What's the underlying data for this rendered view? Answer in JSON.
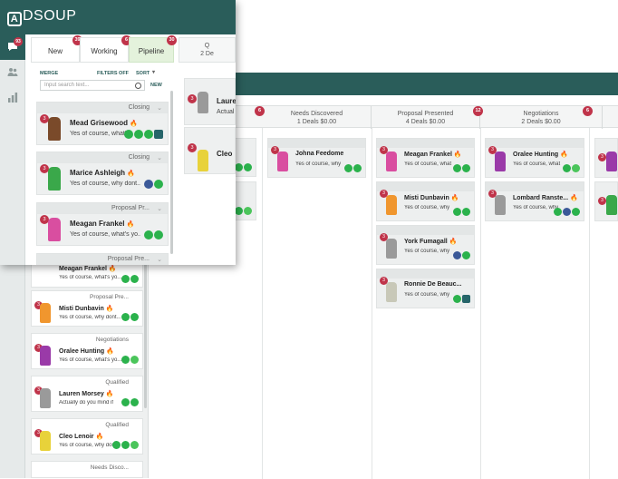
{
  "brand": {
    "name": "DSOUP",
    "mark": "A"
  },
  "front": {
    "rail": {
      "chat_badge": "93"
    },
    "tabs": [
      {
        "label": "New",
        "badge": "39"
      },
      {
        "label": "Working",
        "badge": "6"
      },
      {
        "label": "Pipeline",
        "badge": "30"
      }
    ],
    "toolbar": {
      "merge": "MERGE",
      "filters": "FILTERS OFF",
      "sort": "SORT"
    },
    "search": {
      "placeholder": "Input search text...",
      "new_label": "NEW"
    },
    "cards": [
      {
        "stage": "Closing",
        "name": "Mead Grisewood",
        "message": "Yes of course, what's",
        "badge": "3"
      },
      {
        "stage": "Closing",
        "name": "Marice Ashleigh",
        "message": "Yes of course, why dont...",
        "badge": "3"
      },
      {
        "stage": "Proposal Pr...",
        "name": "Meagan Frankel",
        "message": "Yes of course, what's yo...",
        "badge": "3"
      },
      {
        "stage": "Proposal Pre...",
        "name": "",
        "message": "",
        "badge": ""
      }
    ],
    "peek": {
      "header_top": "Q",
      "header_sub": "2 De",
      "cards": [
        {
          "name": "Laure",
          "message": "Actual",
          "badge": "3"
        },
        {
          "name": "Cleo",
          "message": "",
          "badge": "3"
        }
      ]
    }
  },
  "back": {
    "stages": [
      {
        "title": "Needs Discovered",
        "sub": "1 Deals  $0.00",
        "badge": "6"
      },
      {
        "title": "Proposal Presented",
        "sub": "4 Deals  $0.00",
        "badge": "12"
      },
      {
        "title": "Negotiations",
        "sub": "2 Deals  $0.00",
        "badge": "6"
      }
    ],
    "list_cards": [
      {
        "stage": "",
        "name": "Meagan Frankel",
        "message": "Yes of course, what's yo...",
        "badge": ""
      },
      {
        "stage": "Proposal Pre...",
        "name": "Misti Dunbavin",
        "message": "Yes of course, why dont...",
        "badge": "3"
      },
      {
        "stage": "Negotiations",
        "name": "Oralee Hunting",
        "message": "Yes of course, what's yo...",
        "badge": "3"
      },
      {
        "stage": "Qualified",
        "name": "Lauren Morsey",
        "message": "Actually do you mind if",
        "badge": "3"
      },
      {
        "stage": "Qualified",
        "name": "Cleo Lenoir",
        "message": "Yes of course, why don...",
        "badge": "3"
      },
      {
        "stage": "Needs Disco...",
        "name": "",
        "message": "",
        "badge": ""
      }
    ],
    "board": {
      "needs_discovered": [
        {
          "name": "Johna Feedome",
          "message": "Yes of course, why",
          "badge": "3"
        }
      ],
      "proposal_presented": [
        {
          "name": "Meagan Frankel",
          "message": "Yes of course, what",
          "badge": "3"
        },
        {
          "name": "Misti Dunbavin",
          "message": "Yes of course, why",
          "badge": "3"
        },
        {
          "name": "York Fumagall",
          "message": "Yes of course, why",
          "badge": "3"
        },
        {
          "name": "Ronnie De Beauc...",
          "message": "Yes of course, why",
          "badge": "3"
        }
      ],
      "negotiations": [
        {
          "name": "Oralee Hunting",
          "message": "Yes of course, what",
          "badge": "3"
        },
        {
          "name": "Lombard Ranste...",
          "message": "Yes of course, why",
          "badge": "3"
        }
      ]
    }
  },
  "colors": {
    "header": "#2a5d5a",
    "badge": "#c0344a",
    "active_tab": "#e4f2dc",
    "hot": "#f08a2b",
    "channel_green": "#2bb24c",
    "channel_fb": "#3b5998"
  }
}
